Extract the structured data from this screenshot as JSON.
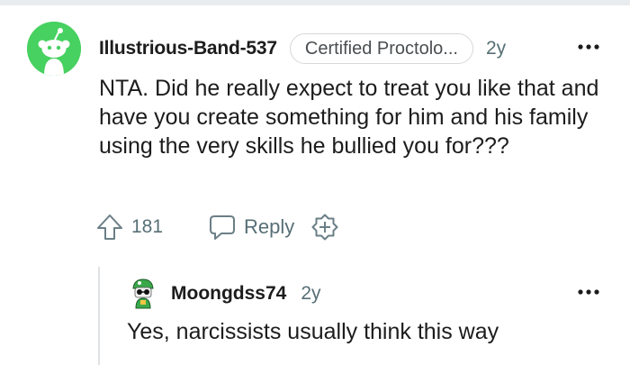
{
  "comment": {
    "username": "Illustrious-Band-537",
    "flair": "Certified Proctolo...",
    "time": "2y",
    "more_icon": "more-horizontal-icon",
    "body": "NTA. Did he really expect to treat you like that and have you create something for him and his family using the very skills he bullied you for???",
    "score": "181",
    "reply_label": "Reply",
    "avatar_color": "#46d160"
  },
  "reply": {
    "username": "Moongdss74",
    "time": "2y",
    "more_icon": "more-horizontal-icon",
    "body": "Yes, narcissists usually think this way"
  },
  "colors": {
    "text": "#1c1c1c",
    "meta": "#576f76",
    "thread_line": "#dfe3e6",
    "flair_border": "#d5d8db"
  }
}
